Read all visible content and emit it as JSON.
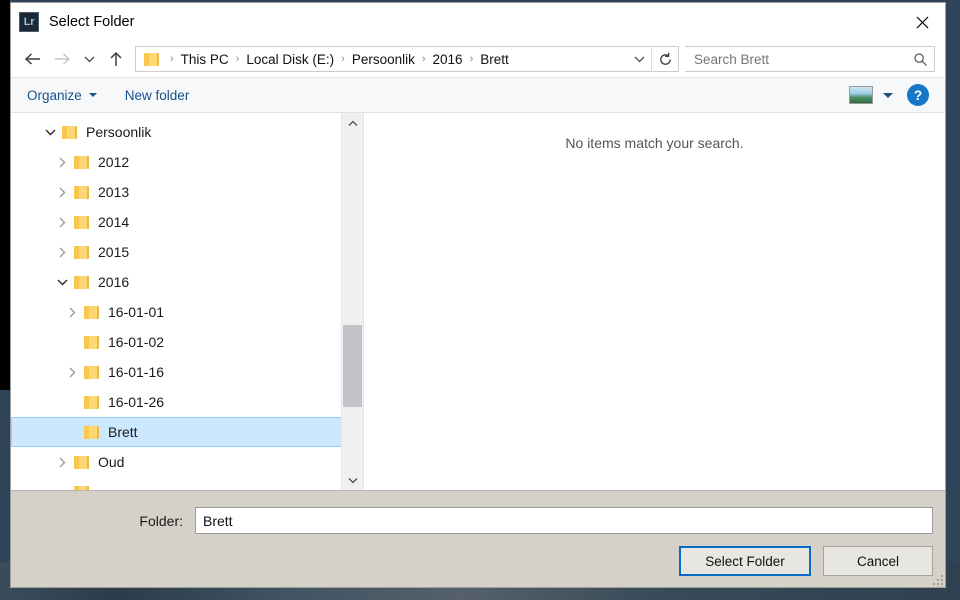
{
  "window": {
    "title": "Select Folder",
    "app_icon": "Lr",
    "close_icon": "close-icon"
  },
  "navigation": {
    "back_icon": "back-arrow-icon",
    "forward_icon": "forward-arrow-icon",
    "recent_icon": "chevron-down-icon",
    "up_icon": "up-arrow-icon",
    "breadcrumbs": [
      "This PC",
      "Local Disk (E:)",
      "Persoonlik",
      "2016",
      "Brett"
    ],
    "separator": "›",
    "dropdown_icon": "chevron-down-icon",
    "refresh_icon": "refresh-icon"
  },
  "search": {
    "placeholder": "Search Brett",
    "value": "",
    "icon": "search-icon"
  },
  "commandbar": {
    "organize_label": "Organize",
    "new_folder_label": "New folder",
    "view_icon": "view-layout-icon",
    "view_caret_icon": "chevron-down-icon",
    "help_label": "?",
    "help_icon": "help-icon"
  },
  "tree": {
    "items": [
      {
        "label": "Persoonlik",
        "level": 0,
        "state": "expanded",
        "selected": false
      },
      {
        "label": "2012",
        "level": 1,
        "state": "collapsed",
        "selected": false
      },
      {
        "label": "2013",
        "level": 1,
        "state": "collapsed",
        "selected": false
      },
      {
        "label": "2014",
        "level": 1,
        "state": "collapsed",
        "selected": false
      },
      {
        "label": "2015",
        "level": 1,
        "state": "collapsed",
        "selected": false
      },
      {
        "label": "2016",
        "level": 1,
        "state": "expanded",
        "selected": false
      },
      {
        "label": "16-01-01",
        "level": 2,
        "state": "collapsed",
        "selected": false
      },
      {
        "label": "16-01-02",
        "level": 2,
        "state": "leaf",
        "selected": false
      },
      {
        "label": "16-01-16",
        "level": 2,
        "state": "collapsed",
        "selected": false
      },
      {
        "label": "16-01-26",
        "level": 2,
        "state": "leaf",
        "selected": false
      },
      {
        "label": "Brett",
        "level": 2,
        "state": "leaf",
        "selected": true
      },
      {
        "label": "Oud",
        "level": 1,
        "state": "collapsed",
        "selected": false
      }
    ],
    "scrollbar": {
      "up_icon": "chevron-up-icon",
      "down_icon": "chevron-down-icon"
    }
  },
  "filelist": {
    "empty_message": "No items match your search."
  },
  "footer": {
    "folder_label": "Folder:",
    "folder_value": "Brett",
    "select_button": "Select Folder",
    "cancel_button": "Cancel",
    "resize_grip_icon": "resize-grip-icon"
  },
  "colors": {
    "selection_fill": "#cce8ff",
    "selection_border": "#99d1ff",
    "command_text": "#15528c",
    "default_button_border": "#0a6bc4",
    "folder_yellow": "#fcd773",
    "footer_background": "#d6d1c8",
    "help_blue": "#1676c8"
  }
}
